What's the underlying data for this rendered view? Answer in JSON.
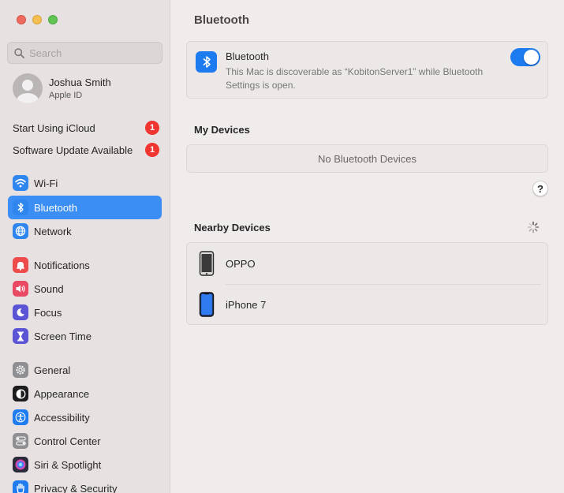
{
  "sidebar": {
    "search_placeholder": "Search",
    "account": {
      "name": "Joshua Smith",
      "subtitle": "Apple ID"
    },
    "alerts": [
      {
        "label": "Start Using iCloud",
        "badge": "1"
      },
      {
        "label": "Software Update Available",
        "badge": "1"
      }
    ],
    "items": [
      {
        "label": "Wi-Fi",
        "icon": "wifi-icon",
        "color": "#2f86ef"
      },
      {
        "label": "Bluetooth",
        "icon": "bluetooth-icon",
        "color": "#2f86ef",
        "active": true
      },
      {
        "label": "Network",
        "icon": "globe-icon",
        "color": "#2f86ef"
      },
      {
        "label": "Notifications",
        "icon": "bell-icon",
        "color": "#ee4b4b"
      },
      {
        "label": "Sound",
        "icon": "speaker-icon",
        "color": "#e94963"
      },
      {
        "label": "Focus",
        "icon": "moon-icon",
        "color": "#5b55d6"
      },
      {
        "label": "Screen Time",
        "icon": "hourglass-icon",
        "color": "#5b55d6"
      },
      {
        "label": "General",
        "icon": "gear-icon",
        "color": "#8e8e93"
      },
      {
        "label": "Appearance",
        "icon": "appearance-icon",
        "color": "#1c1c1e"
      },
      {
        "label": "Accessibility",
        "icon": "accessibility-icon",
        "color": "#1f7cf0"
      },
      {
        "label": "Control Center",
        "icon": "control-center-icon",
        "color": "#8e8e93"
      },
      {
        "label": "Siri & Spotlight",
        "icon": "siri-icon",
        "color": "#2a2a3a"
      },
      {
        "label": "Privacy & Security",
        "icon": "hand-icon",
        "color": "#1f7cf0"
      }
    ]
  },
  "main": {
    "title": "Bluetooth",
    "bluetooth": {
      "label": "Bluetooth",
      "description": "This Mac is discoverable as “KobitonServer1” while Bluetooth Settings is open.",
      "enabled": true
    },
    "my_devices": {
      "title": "My Devices",
      "empty_text": "No Bluetooth Devices"
    },
    "help_label": "?",
    "nearby": {
      "title": "Nearby Devices",
      "devices": [
        {
          "name": "OPPO",
          "icon": "phone-icon"
        },
        {
          "name": "iPhone 7",
          "icon": "iphone-icon"
        }
      ]
    }
  },
  "colors": {
    "accent": "#3b8ef4",
    "badge": "#f0342f"
  }
}
